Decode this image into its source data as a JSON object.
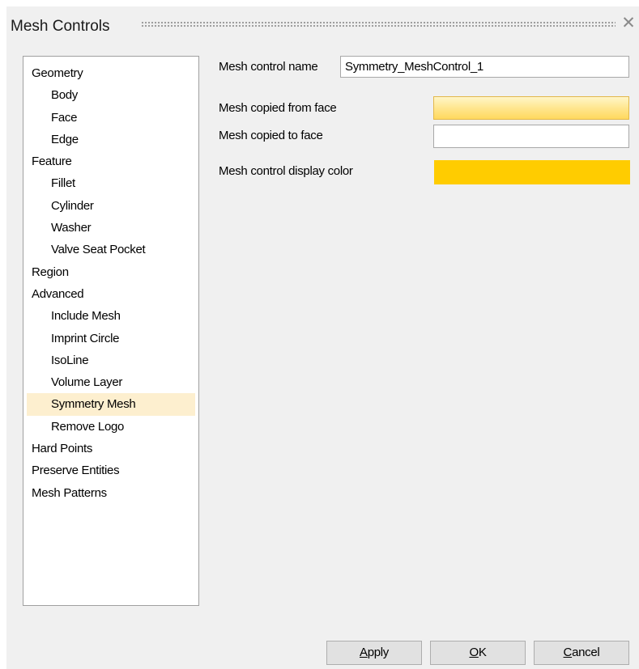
{
  "window": {
    "title": "Mesh Controls",
    "close_glyph": "✕"
  },
  "tree": {
    "items": [
      {
        "label": "Geometry",
        "level": 0
      },
      {
        "label": "Body",
        "level": 1
      },
      {
        "label": "Face",
        "level": 1
      },
      {
        "label": "Edge",
        "level": 1
      },
      {
        "label": "Feature",
        "level": 0
      },
      {
        "label": "Fillet",
        "level": 1
      },
      {
        "label": "Cylinder",
        "level": 1
      },
      {
        "label": "Washer",
        "level": 1
      },
      {
        "label": "Valve Seat Pocket",
        "level": 1
      },
      {
        "label": "Region",
        "level": 0
      },
      {
        "label": "Advanced",
        "level": 0
      },
      {
        "label": "Include Mesh",
        "level": 1
      },
      {
        "label": "Imprint Circle",
        "level": 1
      },
      {
        "label": "IsoLine",
        "level": 1
      },
      {
        "label": "Volume Layer",
        "level": 1
      },
      {
        "label": "Symmetry Mesh",
        "level": 1,
        "selected": true
      },
      {
        "label": "Remove Logo",
        "level": 1
      },
      {
        "label": "Hard Points",
        "level": 0
      },
      {
        "label": "Preserve Entities",
        "level": 0
      },
      {
        "label": "Mesh Patterns",
        "level": 0
      }
    ]
  },
  "form": {
    "name_label": "Mesh control name",
    "name_value": "Symmetry_MeshControl_1",
    "from_face_label": "Mesh copied from face",
    "from_face_value": "",
    "to_face_label": "Mesh copied to face",
    "to_face_value": "",
    "color_label": "Mesh control display color",
    "display_color": "#FFCC00"
  },
  "buttons": {
    "apply": {
      "label": "Apply",
      "mnemonic": "A"
    },
    "ok": {
      "label": "OK",
      "mnemonic": "O"
    },
    "cancel": {
      "label": "Cancel",
      "mnemonic": "C"
    }
  },
  "colors": {
    "selection_highlight": "#FDEFCF",
    "active_field": "#FFE58A",
    "dialog_background": "#F0F0F0"
  }
}
